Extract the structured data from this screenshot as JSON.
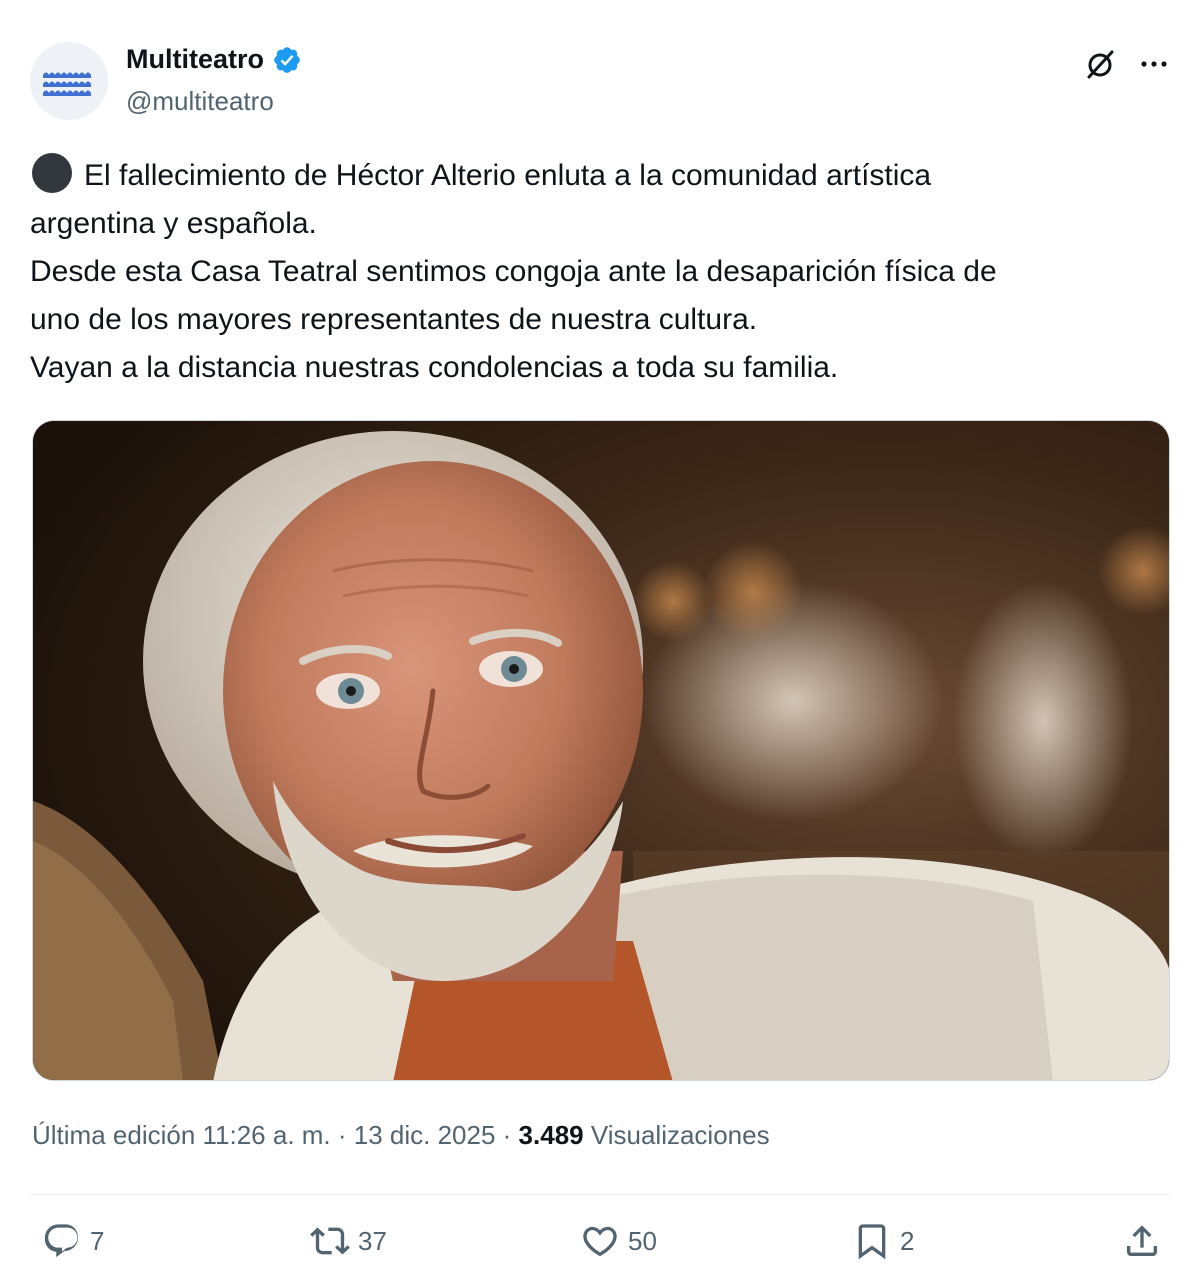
{
  "author": {
    "display_name": "Multiteatro",
    "handle": "@multiteatro",
    "verified": true,
    "verified_color": "#1d9bf0"
  },
  "header_icons": {
    "grok": "grok-slash-circle-icon",
    "more": "more-dots-icon"
  },
  "post": {
    "emoji": "black-circle",
    "lines": [
      "El fallecimiento de Héctor Alterio enluta a la comunidad artística",
      "argentina y española.",
      "Desde esta Casa Teatral sentimos congoja ante la desaparición física de",
      "uno de los mayores representantes de nuestra cultura.",
      "Vayan a la distancia nuestras condolencias a toda su familia."
    ]
  },
  "media": {
    "type": "photo"
  },
  "meta": {
    "edited_prefix": "Última edición 11:26 a. m. · 13 dic. 2025 · ",
    "views_count": "3.489",
    "views_label": " Visualizaciones"
  },
  "actions": {
    "replies": "7",
    "reposts": "37",
    "likes": "50",
    "bookmarks": "2",
    "icon_color": "#536471"
  }
}
